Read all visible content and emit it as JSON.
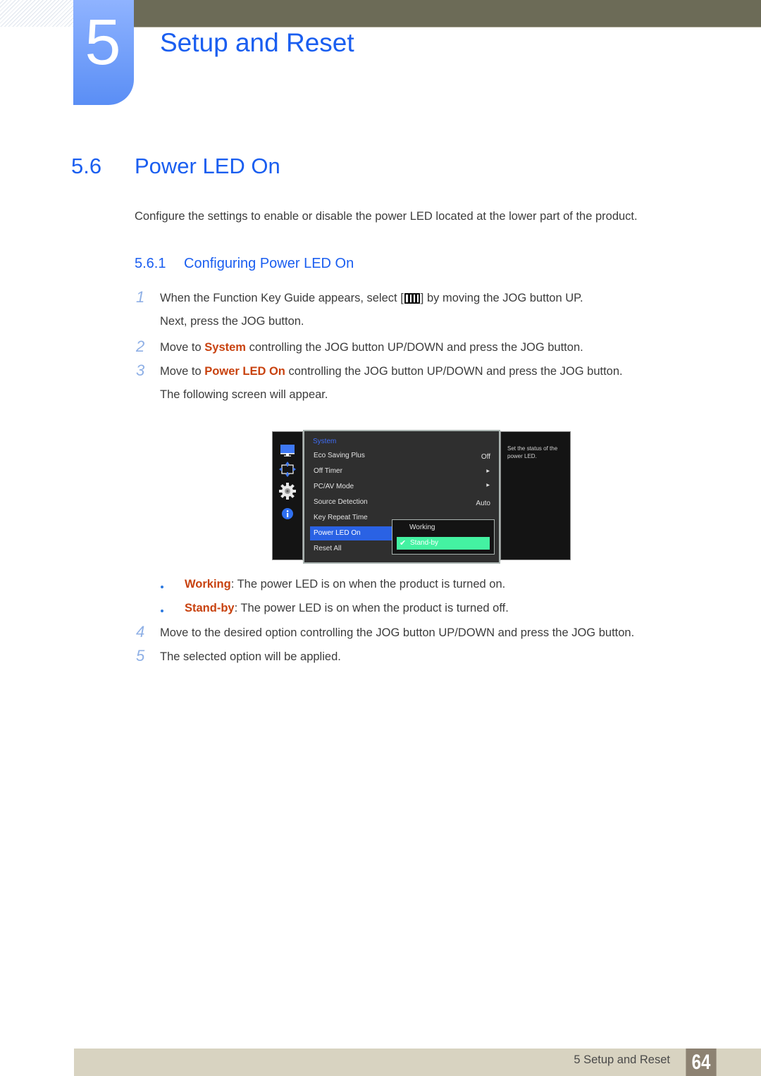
{
  "header": {
    "chapter_number": "5",
    "chapter_title": "Setup and Reset"
  },
  "section": {
    "number": "5.6",
    "title": "Power LED On",
    "intro": "Configure the settings to enable or disable the power LED located at the lower part of the product."
  },
  "subsection": {
    "number": "5.6.1",
    "title": "Configuring Power LED On"
  },
  "steps": [
    {
      "num": "1",
      "pre": "When the Function Key Guide appears, select [",
      "icon": "menu-icon",
      "post": "] by moving the JOG button UP.",
      "line2": "Next, press the JOG button."
    },
    {
      "num": "2",
      "pre": "Move to ",
      "highlight": "System",
      "post": " controlling the JOG button UP/DOWN and press the JOG button."
    },
    {
      "num": "3",
      "pre": "Move to ",
      "highlight": "Power LED On",
      "post": " controlling the JOG button UP/DOWN and press the JOG button.",
      "line2": "The following screen will appear."
    },
    {
      "num": "4",
      "text": "Move to the desired option controlling the JOG button UP/DOWN and press the JOG button."
    },
    {
      "num": "5",
      "text": "The selected option will be applied."
    }
  ],
  "options": [
    {
      "name": "Working",
      "desc": ": The power LED is on when the product is turned on."
    },
    {
      "name": "Stand-by",
      "desc": ": The power LED is on when the product is turned off."
    }
  ],
  "osd": {
    "category": "System",
    "side_icons": [
      "monitor-icon",
      "resize-arrows-icon",
      "gear-icon",
      "info-icon"
    ],
    "items": [
      {
        "label": "Eco Saving Plus",
        "value": "Off"
      },
      {
        "label": "Off Timer",
        "value": "▶"
      },
      {
        "label": "PC/AV Mode",
        "value": "▶"
      },
      {
        "label": "Source Detection",
        "value": "Auto"
      },
      {
        "label": "Key Repeat Time",
        "value": ""
      },
      {
        "label": "Power LED On",
        "value": "",
        "selected": true
      },
      {
        "label": "Reset All",
        "value": ""
      }
    ],
    "submenu": [
      {
        "label": "Working",
        "checked": false
      },
      {
        "label": "Stand-by",
        "checked": true
      }
    ],
    "help_text": "Set the status of the power LED.",
    "colors": {
      "highlight": "#2a62e4",
      "selected_option": "#44f2a2",
      "category": "#3f6cf5"
    }
  },
  "footer": {
    "label": "5 Setup and Reset",
    "page": "64"
  },
  "colors": {
    "accent": "#1a5ef0",
    "highlight_text": "#c8420f"
  }
}
